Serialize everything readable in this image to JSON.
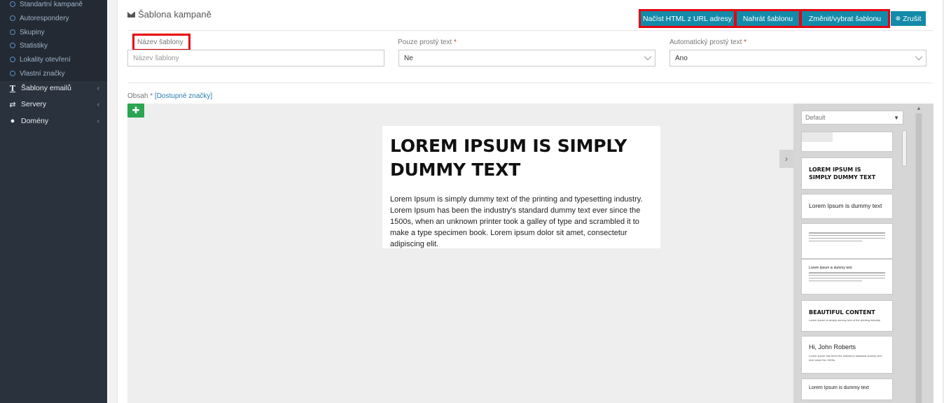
{
  "sidebar": {
    "sub_items": [
      {
        "label": "Standartní kampaně"
      },
      {
        "label": "Autorespondery"
      },
      {
        "label": "Skupiny"
      },
      {
        "label": "Statistiky"
      },
      {
        "label": "Lokality otevření"
      },
      {
        "label": "Vlastní značky"
      }
    ],
    "nav_items": [
      {
        "label": "Šablony emailů",
        "icon": "text-icon",
        "chevron": "‹"
      },
      {
        "label": "Servery",
        "icon": "exchange-icon",
        "chevron": "‹"
      },
      {
        "label": "Domény",
        "icon": "globe-icon",
        "chevron": "‹"
      }
    ]
  },
  "header": {
    "title": "Šablona kampaně",
    "buttons": {
      "load_url": "Načíst HTML z URL adresy",
      "upload": "Nahrát šablonu",
      "change": "Změnit/vybrat šablonu",
      "cancel": "Zrušit"
    }
  },
  "form": {
    "name": {
      "label": "Název šablony",
      "placeholder": "Název šablony"
    },
    "plain_text": {
      "label": "Pouze prostý text",
      "required_mark": "*",
      "value": "Ne"
    },
    "auto_plain": {
      "label": "Automatický prostý text",
      "required_mark": "*",
      "value": "Ano"
    }
  },
  "content": {
    "label": "Obsah *",
    "tags_link": "[Dostupné značky]"
  },
  "editor": {
    "heading": "LOREM IPSUM IS SIMPLY DUMMY TEXT",
    "body": "Lorem Ipsum is simply dummy text of the printing and typesetting industry. Lorem Ipsum has been the industry's standard dummy text ever since the 1500s, when an unknown printer took a galley of type and scrambled it to make a type specimen book. Lorem ipsum dolor sit amet, consectetur adipiscing elit.",
    "side_panel": {
      "select_value": "Default",
      "blocks": {
        "heading": "LOREM IPSUM IS SIMPLY DUMMY TEXT",
        "text": "Lorem Ipsum is dummy text",
        "small_title": "Lorem Ipsum is dummy text",
        "beautiful": "BEAUTIFUL CONTENT",
        "beautiful_sub": "Lorem Ipsum is simply dummy text of the printing industry",
        "hi": "Hi, John Roberts",
        "hi_sub": "Lorem Ipsum has been the industry's standard dummy text ever since the 1500s.",
        "last": "Lorem Ipsum is dummy text"
      }
    }
  },
  "colors": {
    "sidebar": "#2a323d",
    "button": "#138aa9",
    "highlight": "#e8000b",
    "add_button": "#2aa552"
  }
}
